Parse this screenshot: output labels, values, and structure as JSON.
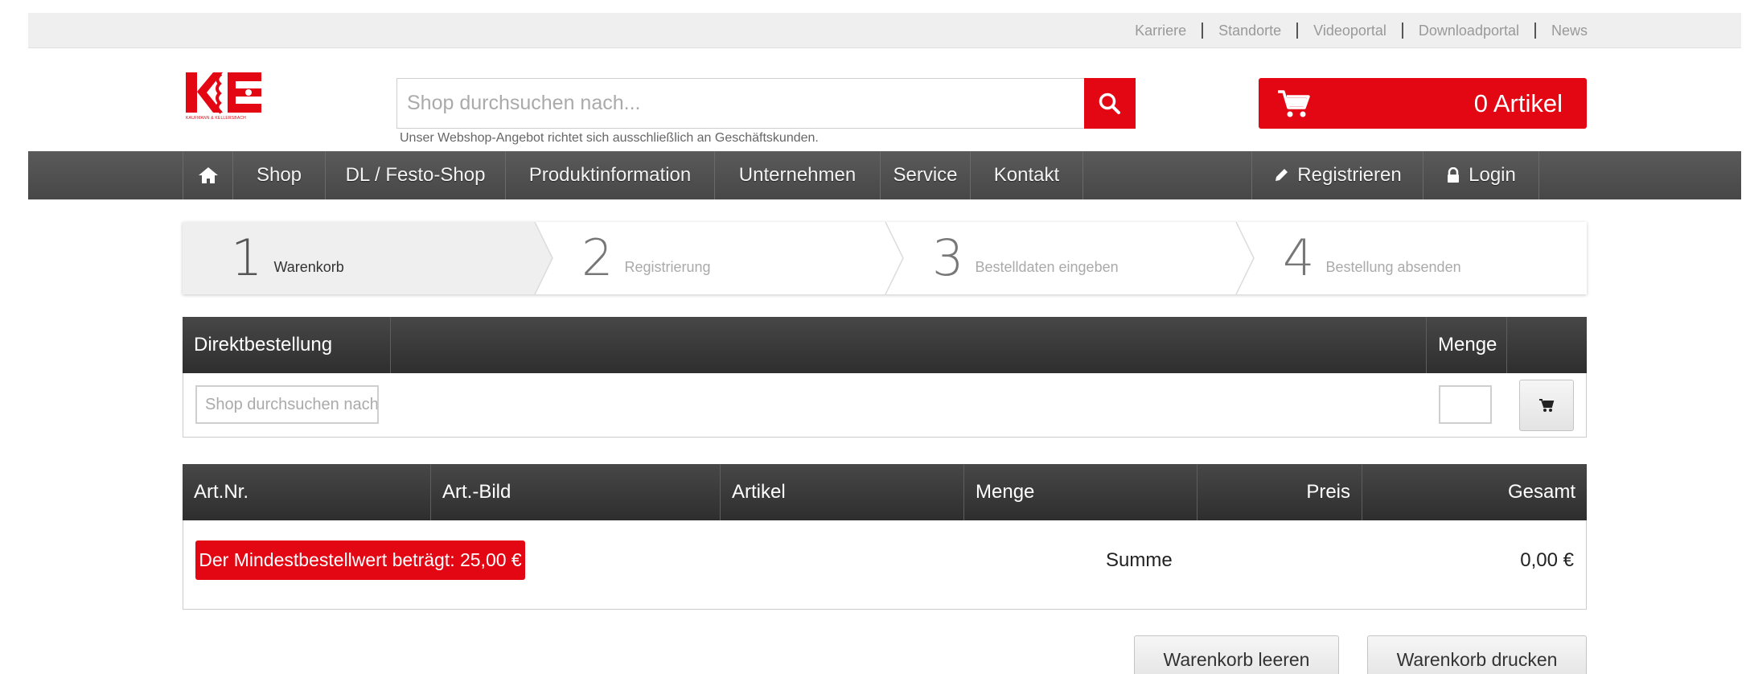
{
  "toplinks": [
    "Karriere",
    "Standorte",
    "Videoportal",
    "Downloadportal",
    "News"
  ],
  "logo": {
    "text": "KE",
    "caption": "KAUFMANN & KELLERSBACH"
  },
  "search": {
    "placeholder": "Shop durchsuchen nach...",
    "hint": "Unser Webshop-Angebot richtet sich ausschließlich an Geschäftskunden."
  },
  "cart": {
    "count_label": "0 Artikel"
  },
  "nav": {
    "items": [
      "Shop",
      "DL / Festo-Shop",
      "Produktinformation",
      "Unternehmen",
      "Service",
      "Kontakt"
    ],
    "register": "Registrieren",
    "login": "Login"
  },
  "steps": [
    {
      "num": "1",
      "label": "Warenkorb",
      "active": true
    },
    {
      "num": "2",
      "label": "Registrierung",
      "active": false
    },
    {
      "num": "3",
      "label": "Bestelldaten eingeben",
      "active": false
    },
    {
      "num": "4",
      "label": "Bestellung absenden",
      "active": false
    }
  ],
  "direct": {
    "header": "Direktbestellung",
    "qty_header": "Menge",
    "input_placeholder": "Shop durchsuchen nach..."
  },
  "cart_table": {
    "headers": [
      "Art.Nr.",
      "Art.-Bild",
      "Artikel",
      "Menge",
      "Preis",
      "Gesamt"
    ],
    "min_order_alert": "Der Mindestbestellwert beträgt: 25,00 €",
    "sum_label": "Summe",
    "sum_value": "0,00 €"
  },
  "actions": {
    "clear": "Warenkorb leeren",
    "print": "Warenkorb drucken"
  },
  "colors": {
    "brand_red": "#e30613",
    "nav_dark": "#4f4f4f",
    "table_head": "#3a3a3a"
  }
}
